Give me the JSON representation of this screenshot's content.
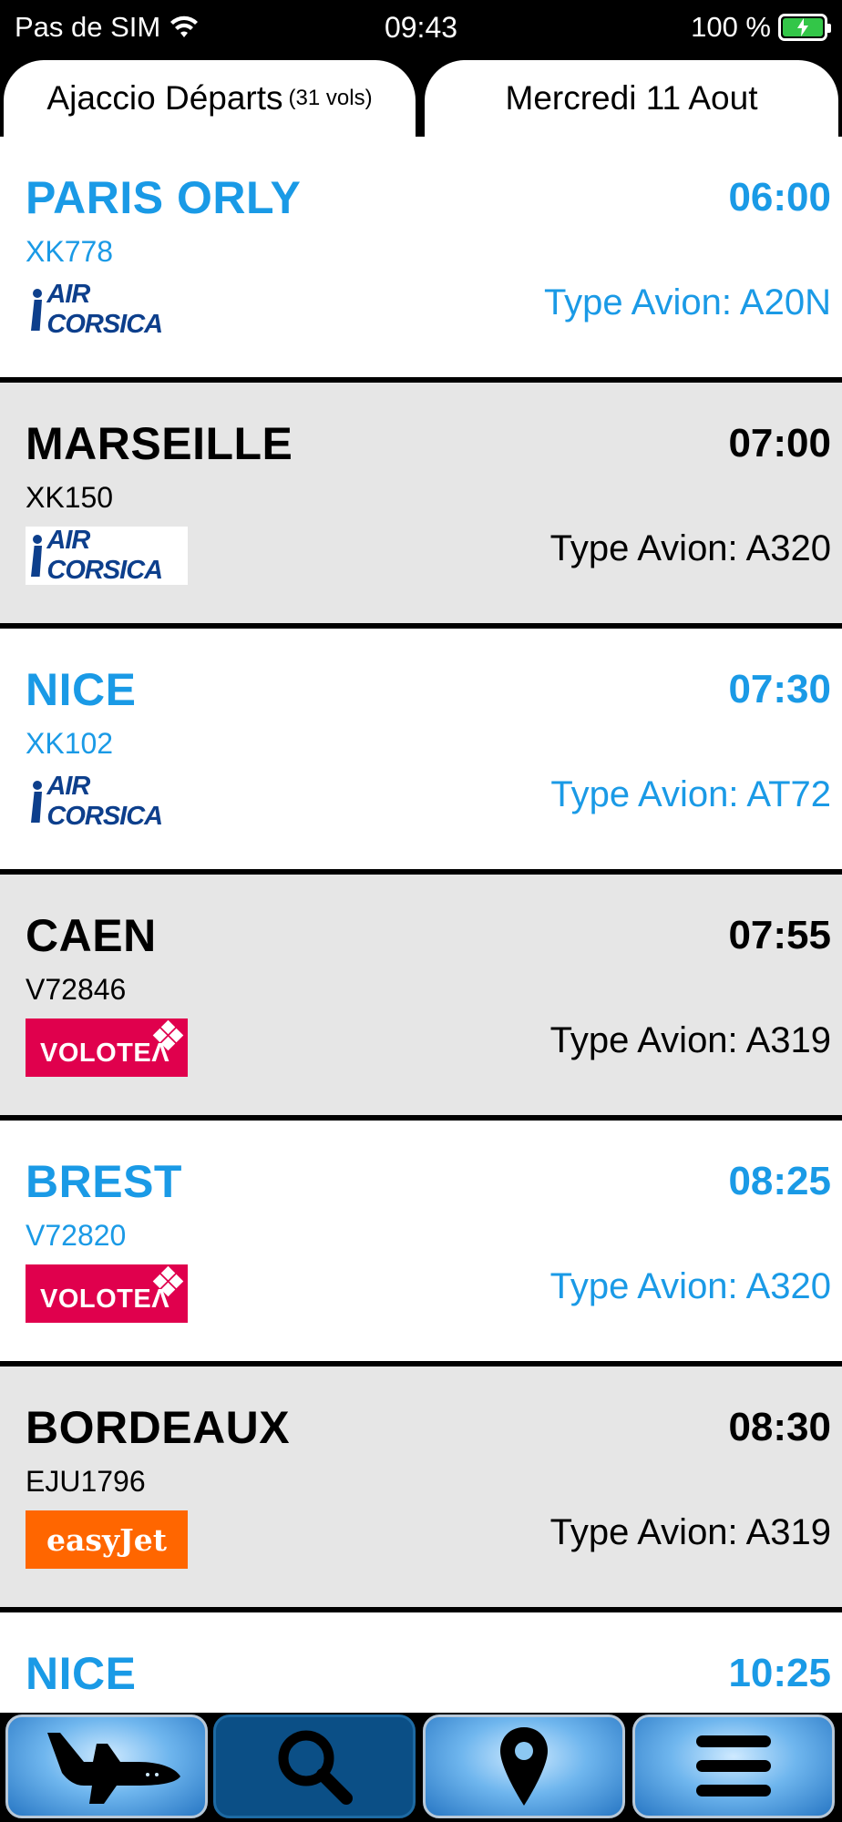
{
  "status_bar": {
    "carrier": "Pas de SIM",
    "time": "09:43",
    "battery": "100 %"
  },
  "header": {
    "left_tab_title": "Ajaccio Départs",
    "left_tab_count": "(31 vols)",
    "right_tab_date": "Mercredi 11 Aout"
  },
  "flights": [
    {
      "destination": "PARIS ORLY",
      "time": "06:00",
      "flight_no": "XK778",
      "aircraft": "Type Avion: A20N",
      "airline_logo": "AIR CORSICA"
    },
    {
      "destination": "MARSEILLE",
      "time": "07:00",
      "flight_no": "XK150",
      "aircraft": "Type Avion: A320",
      "airline_logo": "AIR CORSICA"
    },
    {
      "destination": "NICE",
      "time": "07:30",
      "flight_no": "XK102",
      "aircraft": "Type Avion: AT72",
      "airline_logo": "AIR CORSICA"
    },
    {
      "destination": "CAEN",
      "time": "07:55",
      "flight_no": "V72846",
      "aircraft": "Type Avion: A319",
      "airline_logo": "VOLOTEΛ"
    },
    {
      "destination": "BREST",
      "time": "08:25",
      "flight_no": "V72820",
      "aircraft": "Type Avion: A320",
      "airline_logo": "VOLOTEΛ"
    },
    {
      "destination": "BORDEAUX",
      "time": "08:30",
      "flight_no": "EJU1796",
      "aircraft": "Type Avion: A319",
      "airline_logo": "easyJet"
    },
    {
      "destination": "NICE",
      "time": "10:25",
      "flight_no": "",
      "aircraft": "",
      "airline_logo": ""
    }
  ],
  "colors": {
    "accent_blue": "#1a9ae6",
    "row_grey": "#e6e6e6",
    "aircorsica_navy": "#0d3f8c",
    "volotea_pink": "#e0004d",
    "easyjet_orange": "#ff6600"
  },
  "bottom_nav": [
    {
      "icon": "airplane-icon"
    },
    {
      "icon": "search-icon"
    },
    {
      "icon": "location-pin-icon"
    },
    {
      "icon": "menu-icon"
    }
  ]
}
